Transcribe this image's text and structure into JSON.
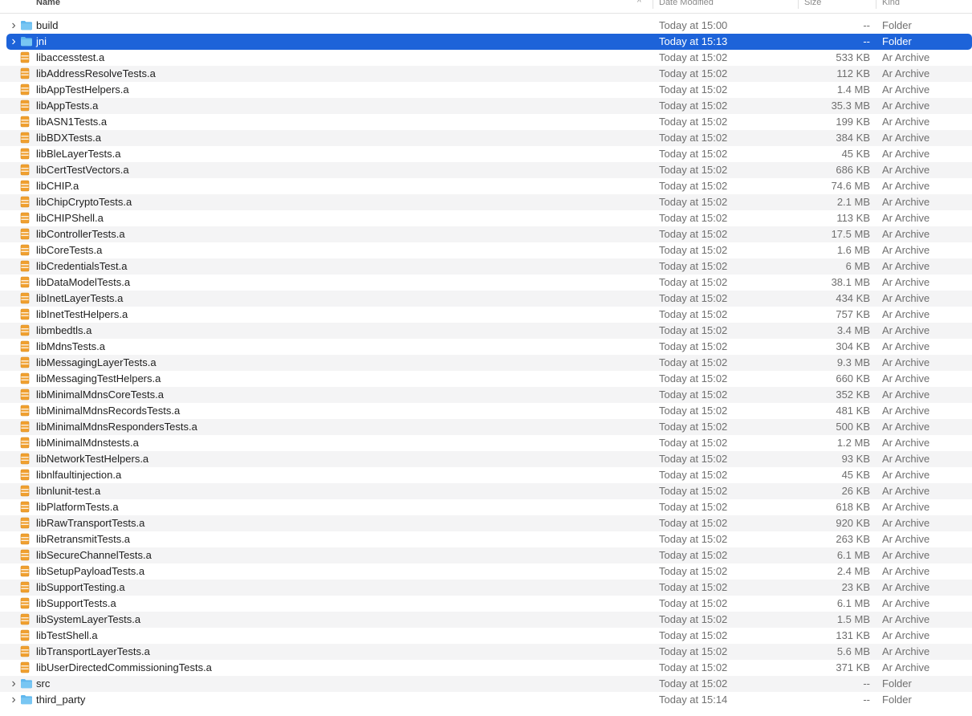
{
  "columns": {
    "name": "Name",
    "date": "Date Modified",
    "size": "Size",
    "kind": "Kind",
    "sort_indicator": "^"
  },
  "colors": {
    "selection": "#1d63d9",
    "folder": "#5fb7ee",
    "archive": "#f0a030"
  },
  "rows": [
    {
      "name": "build",
      "date": "Today at 15:00",
      "size": "--",
      "kind": "Folder",
      "type": "folder",
      "icon": "folder-icon"
    },
    {
      "name": "jni",
      "date": "Today at 15:13",
      "size": "--",
      "kind": "Folder",
      "type": "folder",
      "icon": "folder-icon",
      "selected": true
    },
    {
      "name": "libaccesstest.a",
      "date": "Today at 15:02",
      "size": "533 KB",
      "kind": "Ar Archive",
      "type": "archive",
      "icon": "archive-icon"
    },
    {
      "name": "libAddressResolveTests.a",
      "date": "Today at 15:02",
      "size": "112 KB",
      "kind": "Ar Archive",
      "type": "archive",
      "icon": "archive-icon"
    },
    {
      "name": "libAppTestHelpers.a",
      "date": "Today at 15:02",
      "size": "1.4 MB",
      "kind": "Ar Archive",
      "type": "archive",
      "icon": "archive-icon"
    },
    {
      "name": "libAppTests.a",
      "date": "Today at 15:02",
      "size": "35.3 MB",
      "kind": "Ar Archive",
      "type": "archive",
      "icon": "archive-icon"
    },
    {
      "name": "libASN1Tests.a",
      "date": "Today at 15:02",
      "size": "199 KB",
      "kind": "Ar Archive",
      "type": "archive",
      "icon": "archive-icon"
    },
    {
      "name": "libBDXTests.a",
      "date": "Today at 15:02",
      "size": "384 KB",
      "kind": "Ar Archive",
      "type": "archive",
      "icon": "archive-icon"
    },
    {
      "name": "libBleLayerTests.a",
      "date": "Today at 15:02",
      "size": "45 KB",
      "kind": "Ar Archive",
      "type": "archive",
      "icon": "archive-icon"
    },
    {
      "name": "libCertTestVectors.a",
      "date": "Today at 15:02",
      "size": "686 KB",
      "kind": "Ar Archive",
      "type": "archive",
      "icon": "archive-icon"
    },
    {
      "name": "libCHIP.a",
      "date": "Today at 15:02",
      "size": "74.6 MB",
      "kind": "Ar Archive",
      "type": "archive",
      "icon": "archive-icon"
    },
    {
      "name": "libChipCryptoTests.a",
      "date": "Today at 15:02",
      "size": "2.1 MB",
      "kind": "Ar Archive",
      "type": "archive",
      "icon": "archive-icon"
    },
    {
      "name": "libCHIPShell.a",
      "date": "Today at 15:02",
      "size": "113 KB",
      "kind": "Ar Archive",
      "type": "archive",
      "icon": "archive-icon"
    },
    {
      "name": "libControllerTests.a",
      "date": "Today at 15:02",
      "size": "17.5 MB",
      "kind": "Ar Archive",
      "type": "archive",
      "icon": "archive-icon"
    },
    {
      "name": "libCoreTests.a",
      "date": "Today at 15:02",
      "size": "1.6 MB",
      "kind": "Ar Archive",
      "type": "archive",
      "icon": "archive-icon"
    },
    {
      "name": "libCredentialsTest.a",
      "date": "Today at 15:02",
      "size": "6 MB",
      "kind": "Ar Archive",
      "type": "archive",
      "icon": "archive-icon"
    },
    {
      "name": "libDataModelTests.a",
      "date": "Today at 15:02",
      "size": "38.1 MB",
      "kind": "Ar Archive",
      "type": "archive",
      "icon": "archive-icon"
    },
    {
      "name": "libInetLayerTests.a",
      "date": "Today at 15:02",
      "size": "434 KB",
      "kind": "Ar Archive",
      "type": "archive",
      "icon": "archive-icon"
    },
    {
      "name": "libInetTestHelpers.a",
      "date": "Today at 15:02",
      "size": "757 KB",
      "kind": "Ar Archive",
      "type": "archive",
      "icon": "archive-icon"
    },
    {
      "name": "libmbedtls.a",
      "date": "Today at 15:02",
      "size": "3.4 MB",
      "kind": "Ar Archive",
      "type": "archive",
      "icon": "archive-icon"
    },
    {
      "name": "libMdnsTests.a",
      "date": "Today at 15:02",
      "size": "304 KB",
      "kind": "Ar Archive",
      "type": "archive",
      "icon": "archive-icon"
    },
    {
      "name": "libMessagingLayerTests.a",
      "date": "Today at 15:02",
      "size": "9.3 MB",
      "kind": "Ar Archive",
      "type": "archive",
      "icon": "archive-icon"
    },
    {
      "name": "libMessagingTestHelpers.a",
      "date": "Today at 15:02",
      "size": "660 KB",
      "kind": "Ar Archive",
      "type": "archive",
      "icon": "archive-icon"
    },
    {
      "name": "libMinimalMdnsCoreTests.a",
      "date": "Today at 15:02",
      "size": "352 KB",
      "kind": "Ar Archive",
      "type": "archive",
      "icon": "archive-icon"
    },
    {
      "name": "libMinimalMdnsRecordsTests.a",
      "date": "Today at 15:02",
      "size": "481 KB",
      "kind": "Ar Archive",
      "type": "archive",
      "icon": "archive-icon"
    },
    {
      "name": "libMinimalMdnsRespondersTests.a",
      "date": "Today at 15:02",
      "size": "500 KB",
      "kind": "Ar Archive",
      "type": "archive",
      "icon": "archive-icon"
    },
    {
      "name": "libMinimalMdnstests.a",
      "date": "Today at 15:02",
      "size": "1.2 MB",
      "kind": "Ar Archive",
      "type": "archive",
      "icon": "archive-icon"
    },
    {
      "name": "libNetworkTestHelpers.a",
      "date": "Today at 15:02",
      "size": "93 KB",
      "kind": "Ar Archive",
      "type": "archive",
      "icon": "archive-icon"
    },
    {
      "name": "libnlfaultinjection.a",
      "date": "Today at 15:02",
      "size": "45 KB",
      "kind": "Ar Archive",
      "type": "archive",
      "icon": "archive-icon"
    },
    {
      "name": "libnlunit-test.a",
      "date": "Today at 15:02",
      "size": "26 KB",
      "kind": "Ar Archive",
      "type": "archive",
      "icon": "archive-icon"
    },
    {
      "name": "libPlatformTests.a",
      "date": "Today at 15:02",
      "size": "618 KB",
      "kind": "Ar Archive",
      "type": "archive",
      "icon": "archive-icon"
    },
    {
      "name": "libRawTransportTests.a",
      "date": "Today at 15:02",
      "size": "920 KB",
      "kind": "Ar Archive",
      "type": "archive",
      "icon": "archive-icon"
    },
    {
      "name": "libRetransmitTests.a",
      "date": "Today at 15:02",
      "size": "263 KB",
      "kind": "Ar Archive",
      "type": "archive",
      "icon": "archive-icon"
    },
    {
      "name": "libSecureChannelTests.a",
      "date": "Today at 15:02",
      "size": "6.1 MB",
      "kind": "Ar Archive",
      "type": "archive",
      "icon": "archive-icon"
    },
    {
      "name": "libSetupPayloadTests.a",
      "date": "Today at 15:02",
      "size": "2.4 MB",
      "kind": "Ar Archive",
      "type": "archive",
      "icon": "archive-icon"
    },
    {
      "name": "libSupportTesting.a",
      "date": "Today at 15:02",
      "size": "23 KB",
      "kind": "Ar Archive",
      "type": "archive",
      "icon": "archive-icon"
    },
    {
      "name": "libSupportTests.a",
      "date": "Today at 15:02",
      "size": "6.1 MB",
      "kind": "Ar Archive",
      "type": "archive",
      "icon": "archive-icon"
    },
    {
      "name": "libSystemLayerTests.a",
      "date": "Today at 15:02",
      "size": "1.5 MB",
      "kind": "Ar Archive",
      "type": "archive",
      "icon": "archive-icon"
    },
    {
      "name": "libTestShell.a",
      "date": "Today at 15:02",
      "size": "131 KB",
      "kind": "Ar Archive",
      "type": "archive",
      "icon": "archive-icon"
    },
    {
      "name": "libTransportLayerTests.a",
      "date": "Today at 15:02",
      "size": "5.6 MB",
      "kind": "Ar Archive",
      "type": "archive",
      "icon": "archive-icon"
    },
    {
      "name": "libUserDirectedCommissioningTests.a",
      "date": "Today at 15:02",
      "size": "371 KB",
      "kind": "Ar Archive",
      "type": "archive",
      "icon": "archive-icon"
    },
    {
      "name": "src",
      "date": "Today at 15:02",
      "size": "--",
      "kind": "Folder",
      "type": "folder",
      "icon": "folder-icon"
    },
    {
      "name": "third_party",
      "date": "Today at 15:14",
      "size": "--",
      "kind": "Folder",
      "type": "folder",
      "icon": "folder-icon"
    }
  ]
}
